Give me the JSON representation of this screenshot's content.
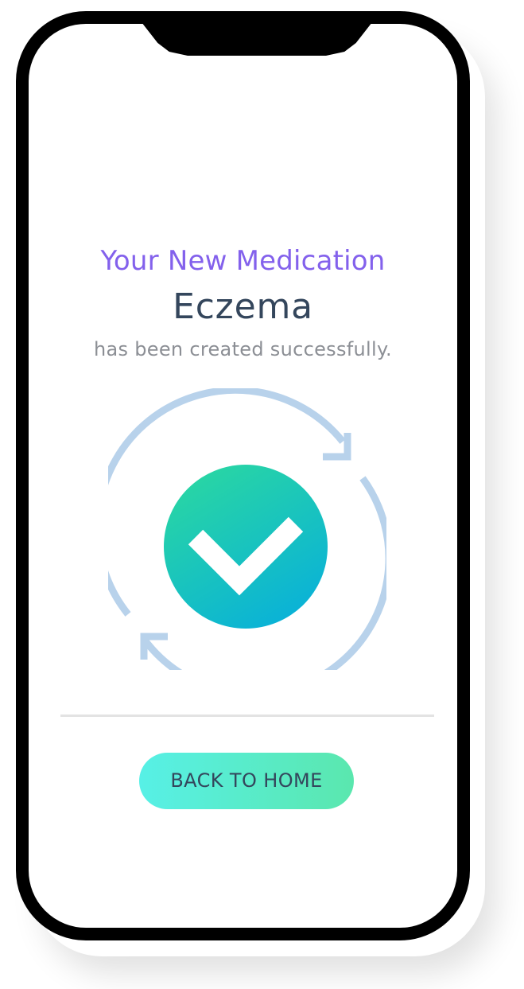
{
  "confirmation": {
    "heading": "Your New Medication",
    "medication_name": "Eczema",
    "message": "has been created successfully."
  },
  "illustration": {
    "icon": "check-icon",
    "cycle_icon": "refresh-arrows-icon",
    "circle_gradient": [
      "#2ad7a2",
      "#08b0da"
    ],
    "arrow_color": "#b8d2eb"
  },
  "actions": {
    "back_home_label": "BACK TO HOME"
  },
  "colors": {
    "heading": "#8361ec",
    "name": "#34465c",
    "message": "#8c8f95",
    "button_gradient": [
      "#57f0e6",
      "#5ae7ae"
    ]
  }
}
